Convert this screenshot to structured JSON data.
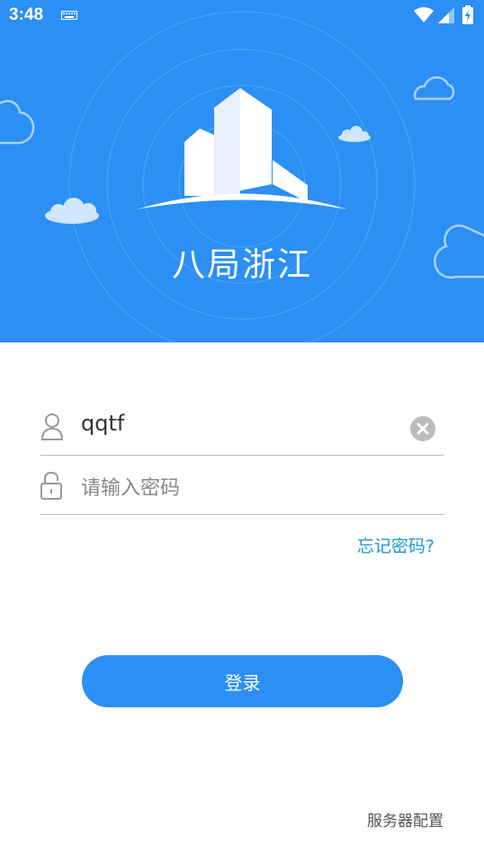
{
  "status_bar": {
    "time": "3:48",
    "icons": [
      "keyboard-icon",
      "wifi-icon",
      "signal-icon",
      "battery-icon"
    ]
  },
  "header": {
    "app_title": "八局浙江",
    "background_color": "#2b8ff4",
    "logo": "building-logo"
  },
  "login_form": {
    "username": {
      "icon": "user-icon",
      "value": "qqtf",
      "clear_icon": "clear-icon"
    },
    "password": {
      "icon": "lock-icon",
      "placeholder": "请输入密码"
    },
    "forgot_password": "忘记密码?",
    "login_button": "登录"
  },
  "footer": {
    "server_config": "服务器配置"
  },
  "colors": {
    "accent": "#2b8ff4",
    "link": "#1c96d9",
    "divider": "#b9b9b9"
  }
}
